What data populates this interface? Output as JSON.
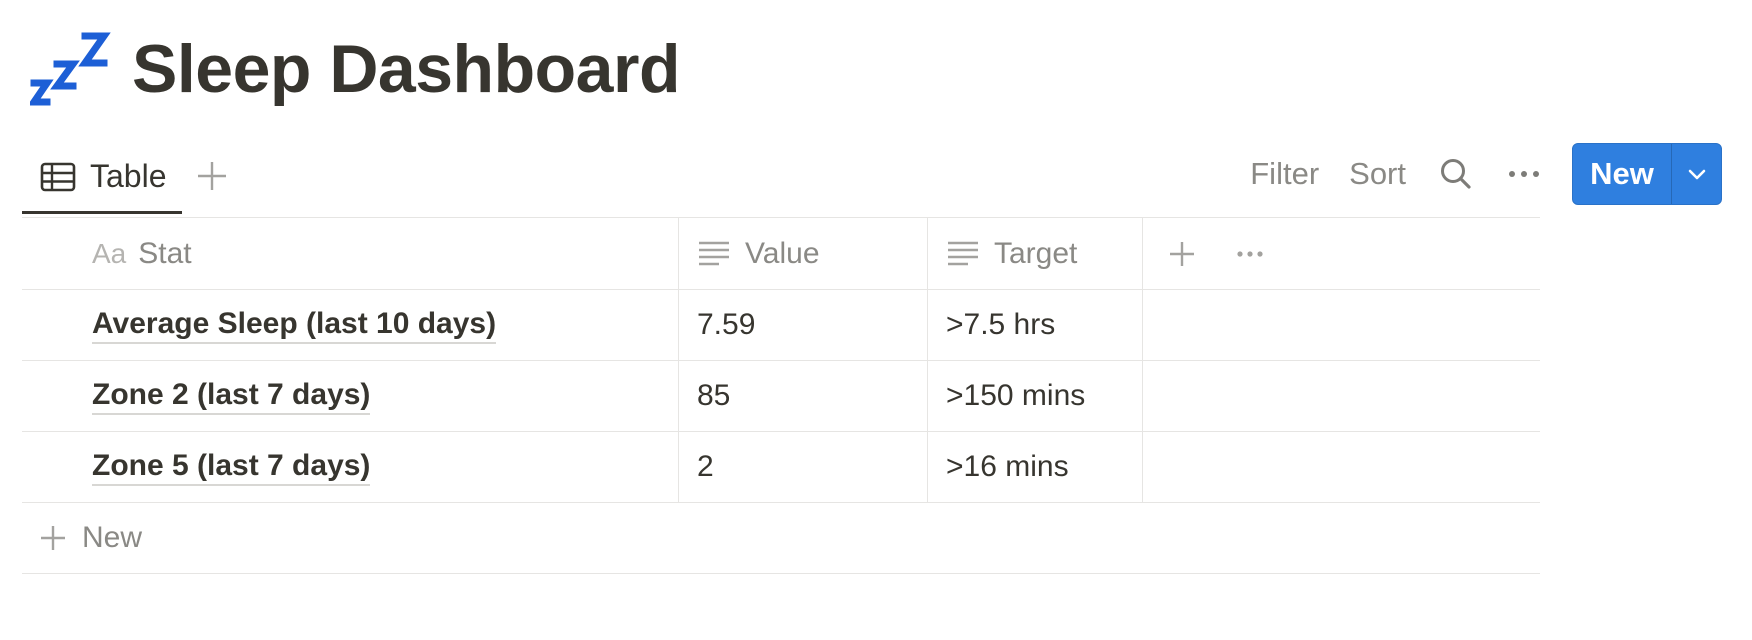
{
  "page": {
    "title": "Sleep Dashboard",
    "icon": "zzz-icon"
  },
  "colors": {
    "accent": "#2f7fdf",
    "text": "#37352f",
    "muted": "#8a8985",
    "divider": "#e6e5e3",
    "icon_blue": "#1d5fd6"
  },
  "viewbar": {
    "active_tab": {
      "label": "Table",
      "icon": "table-icon"
    },
    "add_view_icon": "plus-icon",
    "filter_label": "Filter",
    "sort_label": "Sort",
    "search_icon": "search-icon",
    "more_icon": "ellipsis-icon",
    "new_label": "New",
    "new_dropdown_icon": "chevron-down-icon"
  },
  "table": {
    "columns": [
      {
        "label": "Stat",
        "icon": "title-aa-icon",
        "icon_text": "Aa"
      },
      {
        "label": "Value",
        "icon": "text-lines-icon"
      },
      {
        "label": "Target",
        "icon": "text-lines-icon"
      }
    ],
    "rows": [
      {
        "stat": "Average Sleep (last 10 days)",
        "value": "7.59",
        "target": ">7.5 hrs"
      },
      {
        "stat": "Zone 2 (last 7 days)",
        "value": "85",
        "target": ">150 mins"
      },
      {
        "stat": "Zone 5 (last 7 days)",
        "value": "2",
        "target": ">16 mins"
      }
    ],
    "new_row_label": "New"
  }
}
